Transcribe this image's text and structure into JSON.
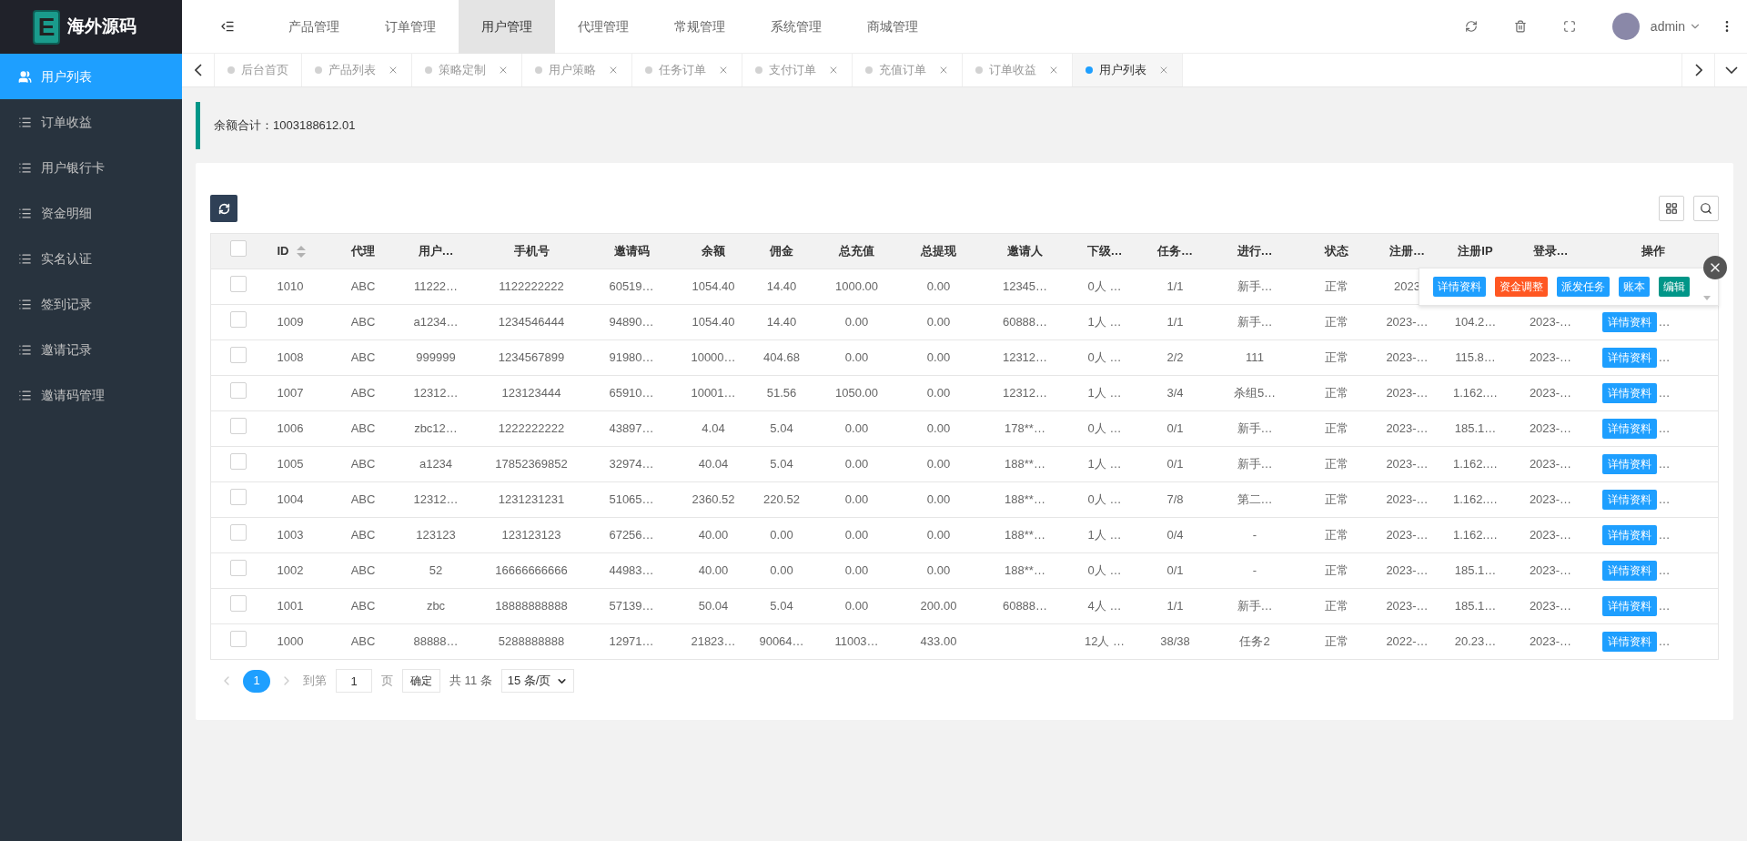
{
  "logo": {
    "letter": "E",
    "title": "海外源码"
  },
  "sidebar": {
    "items": [
      {
        "label": "用户列表",
        "selected": true
      },
      {
        "label": "订单收益",
        "selected": false
      },
      {
        "label": "用户银行卡",
        "selected": false
      },
      {
        "label": "资金明细",
        "selected": false
      },
      {
        "label": "实名认证",
        "selected": false
      },
      {
        "label": "签到记录",
        "selected": false
      },
      {
        "label": "邀请记录",
        "selected": false
      },
      {
        "label": "邀请码管理",
        "selected": false
      }
    ]
  },
  "top_nav": [
    {
      "label": "产品管理",
      "selected": false
    },
    {
      "label": "订单管理",
      "selected": false
    },
    {
      "label": "用户管理",
      "selected": true
    },
    {
      "label": "代理管理",
      "selected": false
    },
    {
      "label": "常规管理",
      "selected": false
    },
    {
      "label": "系统管理",
      "selected": false
    },
    {
      "label": "商城管理",
      "selected": false
    }
  ],
  "user": {
    "name": "admin"
  },
  "page_tabs": [
    {
      "label": "后台首页",
      "selected": false,
      "closable": false
    },
    {
      "label": "产品列表",
      "selected": false,
      "closable": true
    },
    {
      "label": "策略定制",
      "selected": false,
      "closable": true
    },
    {
      "label": "用户策略",
      "selected": false,
      "closable": true
    },
    {
      "label": "任务订单",
      "selected": false,
      "closable": true
    },
    {
      "label": "支付订单",
      "selected": false,
      "closable": true
    },
    {
      "label": "充值订单",
      "selected": false,
      "closable": true
    },
    {
      "label": "订单收益",
      "selected": false,
      "closable": true
    },
    {
      "label": "用户列表",
      "selected": true,
      "closable": true
    }
  ],
  "summary": "余额合计：1003188612.01",
  "table": {
    "header_checkbox": {
      "checked": false
    },
    "columns": [
      {
        "label": "ID",
        "sortable": true
      },
      {
        "label": "代理",
        "sortable": false
      },
      {
        "label": "用户…",
        "sortable": false
      },
      {
        "label": "手机号",
        "sortable": false
      },
      {
        "label": "邀请码",
        "sortable": false
      },
      {
        "label": "余额",
        "sortable": false
      },
      {
        "label": "佣金",
        "sortable": false
      },
      {
        "label": "总充值",
        "sortable": false
      },
      {
        "label": "总提现",
        "sortable": false
      },
      {
        "label": "邀请人",
        "sortable": false
      },
      {
        "label": "下级…",
        "sortable": false
      },
      {
        "label": "任务…",
        "sortable": false
      },
      {
        "label": "进行…",
        "sortable": false
      },
      {
        "label": "状态",
        "sortable": false
      },
      {
        "label": "注册…",
        "sortable": false
      },
      {
        "label": "注册IP",
        "sortable": false
      },
      {
        "label": "登录…",
        "sortable": false
      },
      {
        "label": "操作",
        "sortable": false
      }
    ],
    "rows": [
      {
        "checked": false,
        "cells": [
          "1010",
          "ABC",
          "11222…",
          "1122222222",
          "60519…",
          "1054.40",
          "14.40",
          "1000.00",
          "0.00",
          "12345…",
          "0人 …",
          "1/1",
          "新手…",
          "正常",
          "2023"
        ],
        "popup": [
          {
            "label": "详情资料",
            "color": "#1e9fff"
          },
          {
            "label": "资金调整",
            "color": "#ff5722"
          },
          {
            "label": "派发任务",
            "color": "#1e9fff"
          },
          {
            "label": "账本",
            "color": "#1e9fff"
          },
          {
            "label": "编辑",
            "color": "#009688"
          }
        ]
      },
      {
        "checked": false,
        "cells": [
          "1009",
          "ABC",
          "a1234…",
          "1234546444",
          "94890…",
          "1054.40",
          "14.40",
          "0.00",
          "0.00",
          "60888…",
          "1人 …",
          "1/1",
          "新手…",
          "正常",
          "2023-…",
          "104.2…",
          "2023-…"
        ],
        "action": "详情资料",
        "more": "…"
      },
      {
        "checked": false,
        "cells": [
          "1008",
          "ABC",
          "999999",
          "1234567899",
          "91980…",
          "10000…",
          "404.68",
          "0.00",
          "0.00",
          "12312…",
          "0人 …",
          "2/2",
          "111",
          "正常",
          "2023-…",
          "115.8…",
          "2023-…"
        ],
        "action": "详情资料",
        "more": "…"
      },
      {
        "checked": false,
        "cells": [
          "1007",
          "ABC",
          "12312…",
          "123123444",
          "65910…",
          "10001…",
          "51.56",
          "1050.00",
          "0.00",
          "12312…",
          "1人 …",
          "3/4",
          "杀组5…",
          "正常",
          "2023-…",
          "1.162.…",
          "2023-…"
        ],
        "action": "详情资料",
        "more": "…"
      },
      {
        "checked": false,
        "cells": [
          "1006",
          "ABC",
          "zbc12…",
          "1222222222",
          "43897…",
          "4.04",
          "5.04",
          "0.00",
          "0.00",
          "178**…",
          "0人 …",
          "0/1",
          "新手…",
          "正常",
          "2023-…",
          "185.1…",
          "2023-…"
        ],
        "action": "详情资料",
        "more": "…"
      },
      {
        "checked": false,
        "cells": [
          "1005",
          "ABC",
          "a1234",
          "17852369852",
          "32974…",
          "40.04",
          "5.04",
          "0.00",
          "0.00",
          "188**…",
          "1人 …",
          "0/1",
          "新手…",
          "正常",
          "2023-…",
          "1.162.…",
          "2023-…"
        ],
        "action": "详情资料",
        "more": "…"
      },
      {
        "checked": false,
        "cells": [
          "1004",
          "ABC",
          "12312…",
          "1231231231",
          "51065…",
          "2360.52",
          "220.52",
          "0.00",
          "0.00",
          "188**…",
          "0人 …",
          "7/8",
          "第二…",
          "正常",
          "2023-…",
          "1.162.…",
          "2023-…"
        ],
        "action": "详情资料",
        "more": "…"
      },
      {
        "checked": false,
        "cells": [
          "1003",
          "ABC",
          "123123",
          "123123123",
          "67256…",
          "40.00",
          "0.00",
          "0.00",
          "0.00",
          "188**…",
          "1人 …",
          "0/4",
          "-",
          "正常",
          "2023-…",
          "1.162.…",
          "2023-…"
        ],
        "action": "详情资料",
        "more": "…"
      },
      {
        "checked": false,
        "cells": [
          "1002",
          "ABC",
          "52",
          "16666666666",
          "44983…",
          "40.00",
          "0.00",
          "0.00",
          "0.00",
          "188**…",
          "0人 …",
          "0/1",
          "-",
          "正常",
          "2023-…",
          "185.1…",
          "2023-…"
        ],
        "action": "详情资料",
        "more": "…"
      },
      {
        "checked": false,
        "cells": [
          "1001",
          "ABC",
          "zbc",
          "18888888888",
          "57139…",
          "50.04",
          "5.04",
          "0.00",
          "200.00",
          "60888…",
          "4人 …",
          "1/1",
          "新手…",
          "正常",
          "2023-…",
          "185.1…",
          "2023-…"
        ],
        "action": "详情资料",
        "more": "…"
      },
      {
        "checked": false,
        "cells": [
          "1000",
          "ABC",
          "88888…",
          "5288888888",
          "12971…",
          "21823…",
          "90064…",
          "11003…",
          "433.00",
          "",
          "12人 …",
          "38/38",
          "任务2",
          "正常",
          "2022-…",
          "20.23…",
          "2023-…"
        ],
        "action": "详情资料",
        "more": "…"
      }
    ]
  },
  "pagination": {
    "pages": [
      {
        "label": "1",
        "selected": true
      }
    ],
    "goto_label": "到第",
    "goto_value": "1",
    "page_unit": "页",
    "confirm": "确定",
    "total": "共 11 条",
    "page_size": "15 条/页"
  }
}
